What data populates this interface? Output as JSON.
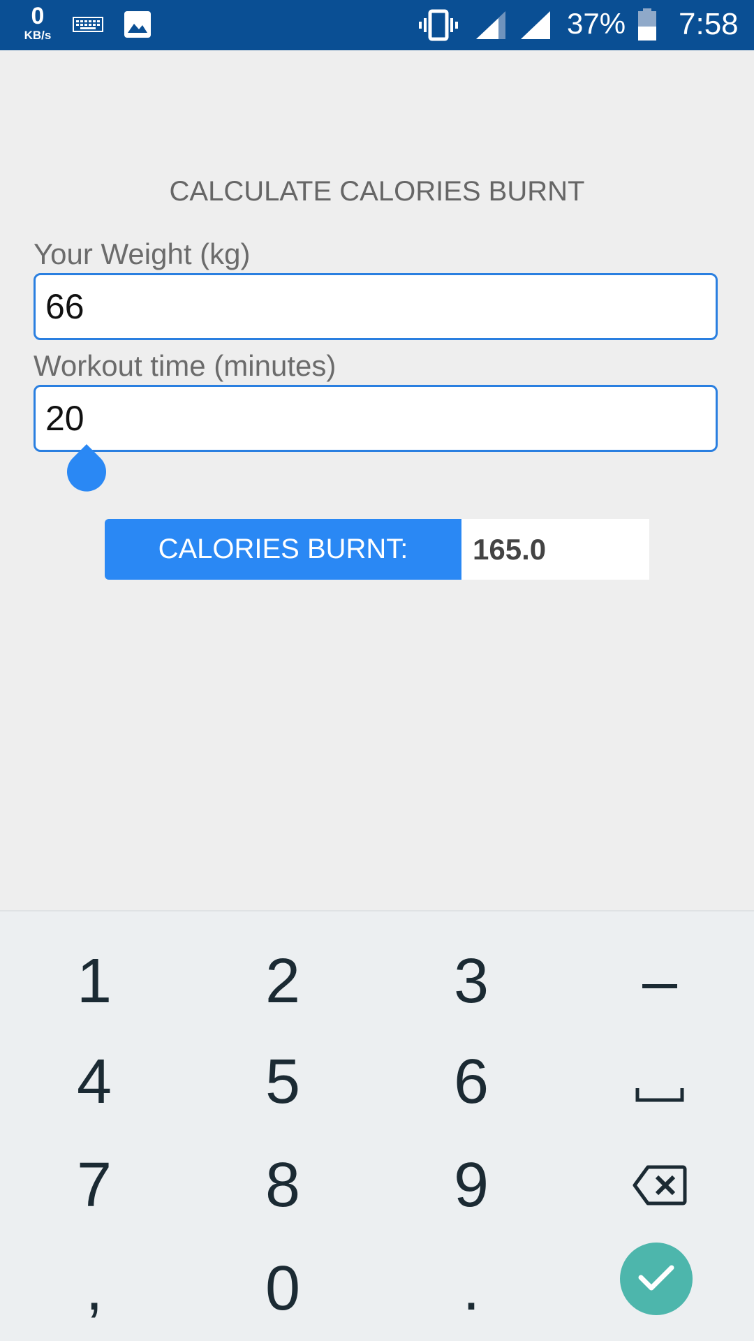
{
  "status_bar": {
    "speed_value": "0",
    "speed_unit": "KB/s",
    "battery_percent": "37%",
    "time": "7:58",
    "icons": [
      "keyboard-icon",
      "image-icon",
      "vibrate-icon",
      "signal-icon",
      "signal-icon",
      "battery-icon"
    ]
  },
  "page": {
    "title": "CALCULATE CALORIES BURNT"
  },
  "form": {
    "weight_label": "Your Weight (kg)",
    "weight_value": "66",
    "time_label": "Workout time (minutes)",
    "time_value": "20"
  },
  "result": {
    "label": "CALORIES BURNT:",
    "value": "165.0"
  },
  "keyboard": {
    "keys": [
      "1",
      "2",
      "3",
      "–",
      "4",
      "5",
      "6",
      "7",
      "8",
      "9",
      ",",
      "0",
      "."
    ],
    "space_icon": "space-icon",
    "backspace_icon": "backspace-icon",
    "enter_icon": "check-icon",
    "accent_color": "#4db6ac"
  },
  "colors": {
    "status_bar": "#0a4f94",
    "accent": "#2a88f4",
    "background": "#eeeeee"
  }
}
